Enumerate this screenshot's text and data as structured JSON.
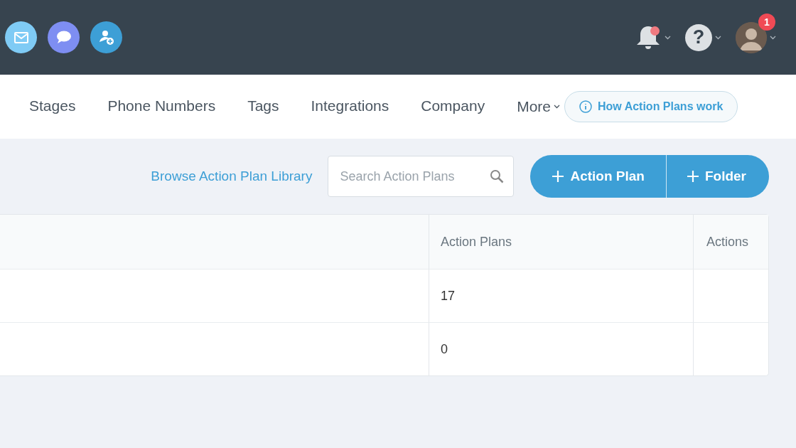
{
  "header_icons": [
    {
      "kind": "mail"
    },
    {
      "kind": "chat"
    },
    {
      "kind": "add-contact"
    }
  ],
  "notifications": {
    "unread": true
  },
  "help_menu": {
    "icon": "?"
  },
  "user_menu": {
    "badge": "1"
  },
  "nav": {
    "tabs": [
      {
        "label": "Stages",
        "selected": false
      },
      {
        "label": "Phone Numbers",
        "selected": false
      },
      {
        "label": "Tags",
        "selected": false
      },
      {
        "label": "Integrations",
        "selected": false
      },
      {
        "label": "Company",
        "selected": false
      }
    ],
    "more": "More",
    "help_button": "How Action Plans work"
  },
  "toolbar": {
    "library_link": "Browse Action Plan Library",
    "search": {
      "placeholder": "Search Action Plans"
    },
    "buttons": [
      {
        "label": "Action Plan"
      },
      {
        "label": "Folder"
      }
    ]
  },
  "table": {
    "columns": [
      "Action Plans",
      "Actions"
    ],
    "rows": [
      {
        "action_plans": "17"
      },
      {
        "action_plans": "0"
      }
    ]
  }
}
